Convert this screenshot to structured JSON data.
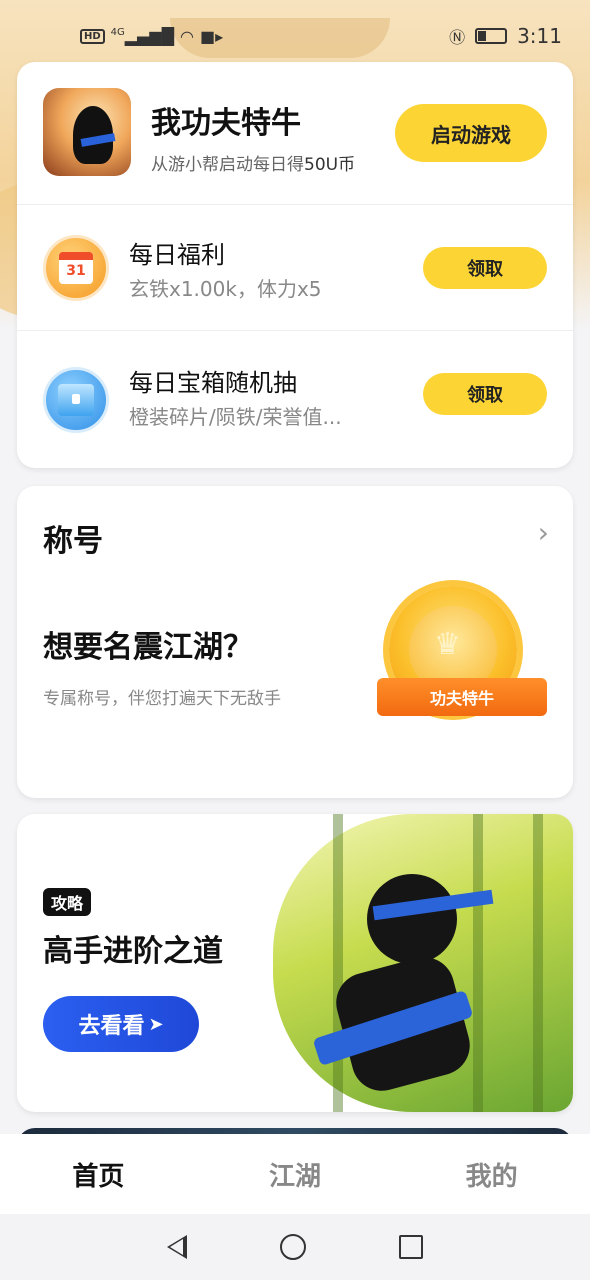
{
  "status_bar": {
    "left_icons": [
      "hd-icon",
      "signal-4g-icon",
      "wifi-icon",
      "video-icon"
    ],
    "hd": "HD",
    "network": "4G",
    "time": "3:11"
  },
  "game": {
    "title": "我功夫特牛",
    "subtitle_prefix": "从游小帮启动每日得",
    "subtitle_reward": "50U币",
    "launch_label": "启动游戏"
  },
  "daily_items": [
    {
      "title": "每日福利",
      "subtitle": "玄铁x1.00k，体力x5",
      "claim_label": "领取",
      "icon": "calendar-icon",
      "icon_text": "31"
    },
    {
      "title": "每日宝箱随机抽",
      "subtitle": "橙装碎片/陨铁/荣誉值...",
      "claim_label": "领取",
      "icon": "treasure-box-icon"
    }
  ],
  "title_card": {
    "section_title": "称号",
    "headline": "想要名震江湖？",
    "description": "专属称号，伴您打遍天下无敌手",
    "badge_text": "功夫特牛"
  },
  "guide_card": {
    "tag": "攻略",
    "headline": "高手进阶之道",
    "button_label": "去看看",
    "button_arrow": "➤"
  },
  "tabs": [
    {
      "label": "首页",
      "active": true
    },
    {
      "label": "江湖",
      "active": false
    },
    {
      "label": "我的",
      "active": false
    }
  ],
  "colors": {
    "accent_yellow": "#fcd535",
    "accent_blue": "#2b5ff0",
    "ribbon_orange": "#f26a10"
  }
}
